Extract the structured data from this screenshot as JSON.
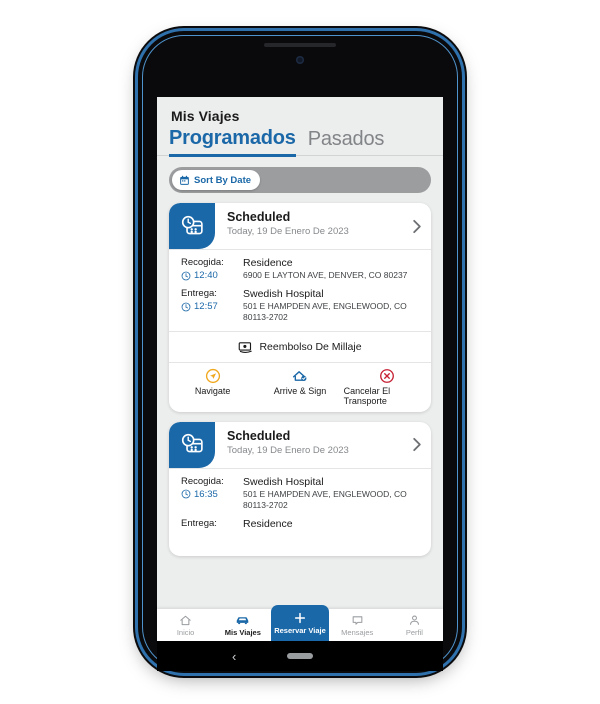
{
  "app": {
    "title": "Mis Viajes",
    "tabs": [
      {
        "label": "Programados",
        "active": true
      },
      {
        "label": "Pasados",
        "active": false
      }
    ],
    "sort": {
      "label": "Sort By Date",
      "icon": "calendar-icon"
    }
  },
  "colors": {
    "primary": "#1b68a8",
    "screen_bg": "#eceded",
    "card_bg": "#ffffff",
    "navigate": "#f0a81e",
    "arrive": "#1b68a8",
    "cancel": "#c62033",
    "muted_text": "#86898c",
    "phone_rim": "#2f71ad"
  },
  "trips": [
    {
      "status": "Scheduled",
      "date": "Today, 19 De Enero De 2023",
      "status_icon": "scheduled-clock-card-icon",
      "pickup": {
        "label": "Recogida:",
        "time": "12:40",
        "place": "Residence",
        "address": "6900 E LAYTON AVE, DENVER, CO 80237"
      },
      "dropoff": {
        "label": "Entrega:",
        "time": "12:57",
        "place": "Swedish Hospital",
        "address": "501 E HAMPDEN AVE, ENGLEWOOD, CO 80113-2702"
      },
      "mileage": {
        "label": "Reembolso De Millaje",
        "icon": "money-bill-icon"
      },
      "actions": [
        {
          "label": "Navigate",
          "icon": "navigate-arrow-icon"
        },
        {
          "label": "Arrive & Sign",
          "icon": "home-check-icon"
        },
        {
          "label": "Cancelar El Transporte",
          "icon": "cancel-circle-icon"
        }
      ]
    },
    {
      "status": "Scheduled",
      "date": "Today, 19 De Enero De 2023",
      "status_icon": "scheduled-clock-card-icon",
      "pickup": {
        "label": "Recogida:",
        "time": "16:35",
        "place": "Swedish Hospital",
        "address": "501 E HAMPDEN AVE, ENGLEWOOD, CO 80113-2702"
      },
      "dropoff": {
        "label": "Entrega:",
        "time": "",
        "place": "Residence",
        "address": ""
      }
    }
  ],
  "bottom_nav": [
    {
      "label": "Inicio",
      "icon": "home-icon",
      "active": false
    },
    {
      "label": "Mis Viajes",
      "icon": "car-icon",
      "active": true
    },
    {
      "label": "Reservar Viaje",
      "icon": "plus-icon",
      "cta": true
    },
    {
      "label": "Mensajes",
      "icon": "chat-icon",
      "active": false
    },
    {
      "label": "Perfil",
      "icon": "person-icon",
      "active": false
    }
  ]
}
